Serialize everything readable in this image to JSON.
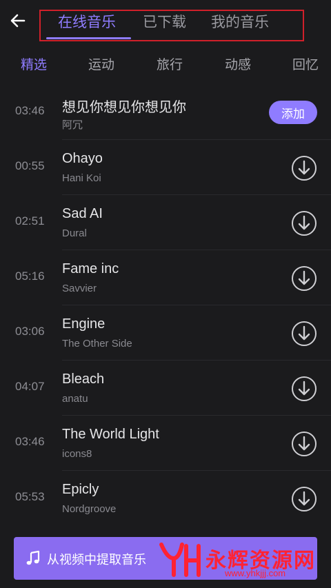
{
  "header": {
    "tabs": [
      {
        "label": "在线音乐",
        "active": true
      },
      {
        "label": "已下载",
        "active": false
      },
      {
        "label": "我的音乐",
        "active": false
      }
    ]
  },
  "categories": [
    {
      "label": "精选",
      "active": true
    },
    {
      "label": "运动",
      "active": false
    },
    {
      "label": "旅行",
      "active": false
    },
    {
      "label": "动感",
      "active": false
    },
    {
      "label": "回忆",
      "active": false
    }
  ],
  "songs": [
    {
      "duration": "03:46",
      "title": "想见你想见你想见你",
      "artist": "阿冗",
      "action": "add"
    },
    {
      "duration": "00:55",
      "title": "Ohayo",
      "artist": "Hani Koi",
      "action": "download"
    },
    {
      "duration": "02:51",
      "title": "Sad AI",
      "artist": "Dural",
      "action": "download"
    },
    {
      "duration": "05:16",
      "title": "Fame inc",
      "artist": "Savvier",
      "action": "download"
    },
    {
      "duration": "03:06",
      "title": "Engine",
      "artist": "The Other Side",
      "action": "download"
    },
    {
      "duration": "04:07",
      "title": "Bleach",
      "artist": "anatu",
      "action": "download"
    },
    {
      "duration": "03:46",
      "title": "The World Light",
      "artist": "icons8",
      "action": "download"
    },
    {
      "duration": "05:53",
      "title": "Epicly",
      "artist": "Nordgroove",
      "action": "download"
    }
  ],
  "add_label": "添加",
  "extract_button": {
    "label": "从视频中提取音乐",
    "icon": "music-note-icon"
  },
  "watermark": {
    "text": "永辉资源网",
    "url": "www.yhkjjj.com"
  },
  "colors": {
    "accent": "#8f7cff",
    "extract_bg": "#8a6cf0",
    "background": "#1b1b1d",
    "highlight_box": "#d0202a",
    "watermark": "#ff2233"
  },
  "icons": {
    "back": "arrow-left-icon",
    "download": "download-circle-icon",
    "music": "music-note-icon"
  }
}
